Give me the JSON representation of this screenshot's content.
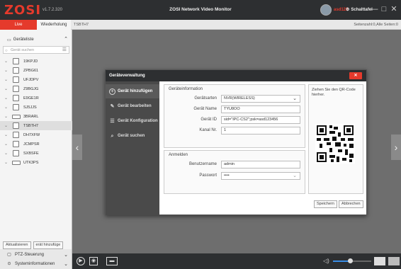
{
  "app": {
    "logo": "ZOSI",
    "version": "v1.7.2.320",
    "title": "ZOSI Network Video Monitor",
    "username": "asd123",
    "switchboard_label": "Schalttafel",
    "minimize": "—",
    "maximize": "□",
    "close": "✕"
  },
  "tabs": {
    "live": "Live",
    "replay": "Wiederholung",
    "current_device": "TSBTH7",
    "page_info": "Seitenzahl:0,Alle Seiten:0"
  },
  "sidebar": {
    "title": "Geräteliste",
    "search_placeholder": "Gerät suchen",
    "devices": [
      {
        "name": "19KPJD",
        "type": "camera"
      },
      {
        "name": "ZPBG61",
        "type": "camera"
      },
      {
        "name": "UFJDPV",
        "type": "camera"
      },
      {
        "name": "Z9BGJG",
        "type": "camera"
      },
      {
        "name": "E9GE1R",
        "type": "camera"
      },
      {
        "name": "SJ5JJS",
        "type": "camera"
      },
      {
        "name": "3BRARL",
        "type": "nvr"
      },
      {
        "name": "TSBTH7",
        "type": "camera",
        "selected": true
      },
      {
        "name": "DH7XFW",
        "type": "camera"
      },
      {
        "name": "JCMPSR",
        "type": "camera"
      },
      {
        "name": "SXBSFE",
        "type": "camera"
      },
      {
        "name": "UTK3PS",
        "type": "nvr"
      }
    ],
    "refresh_button": "Aktualisieren",
    "add_device_button": "erät hinzufüge",
    "ptz_label": "PTZ-Steuerung",
    "sysinfo_label": "Systeminformationen"
  },
  "dialog": {
    "title": "Geräteverwaltung",
    "close_label": "✕",
    "nav": [
      {
        "label": "Gerät hinzufügen",
        "icon": "plus-circle-icon",
        "active": true
      },
      {
        "label": "Gerät bearbeiten",
        "icon": "edit-icon",
        "active": false
      },
      {
        "label": "Gerät Konfiguration",
        "icon": "config-icon",
        "active": false
      },
      {
        "label": "Gerät suchen",
        "icon": "search-icon",
        "active": false
      }
    ],
    "device_info_title": "Geräteinformation",
    "fields": {
      "type_label": "Gerätsarten",
      "type_value": "NVR(WIRELESS)",
      "name_label": "Gerät Name",
      "name_value": "TYU8OO",
      "id_label": "Gerät ID",
      "id_value": "sid=\"IPC-CS2\";psk=asd123456",
      "channel_label": "Kanal Nr.",
      "channel_value": "1"
    },
    "login_title": "Anmelden",
    "login": {
      "user_label": "Benutzername",
      "user_value": "admin",
      "password_label": "Passwort",
      "password_value": "••••"
    },
    "qr_text": "Ziehen Sie den QR-Code hierher.",
    "save_button": "Speichern",
    "cancel_button": "Abbrechen"
  },
  "colors": {
    "accent": "#e53a2c",
    "titlebar": "#2d2f31",
    "dialog_sidebar": "#4a4a4a"
  },
  "volume": {
    "level": 0.45
  }
}
